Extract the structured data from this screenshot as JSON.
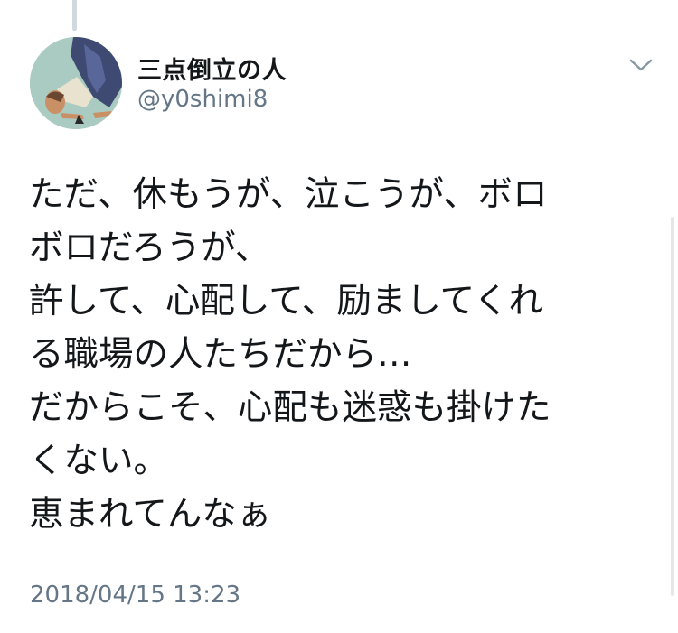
{
  "tweet": {
    "author": {
      "display_name": "三点倒立の人",
      "handle": "@y0shimi8",
      "avatar_icon": "avatar-illustration-icon"
    },
    "menu_icon": "chevron-down-icon",
    "text_lines": [
      "ただ、休もうが、泣こうが、ボロ",
      "ボロだろうが、",
      "許して、心配して、励ましてくれ",
      "る職場の人たちだから…",
      "だからこそ、心配も迷惑も掛けた",
      "くない。",
      "恵まれてんなぁ"
    ],
    "timestamp": "2018/04/15 13:23"
  },
  "colors": {
    "text": "#14171a",
    "secondary": "#657786",
    "thread_line": "#cfd9de",
    "background": "#ffffff"
  }
}
